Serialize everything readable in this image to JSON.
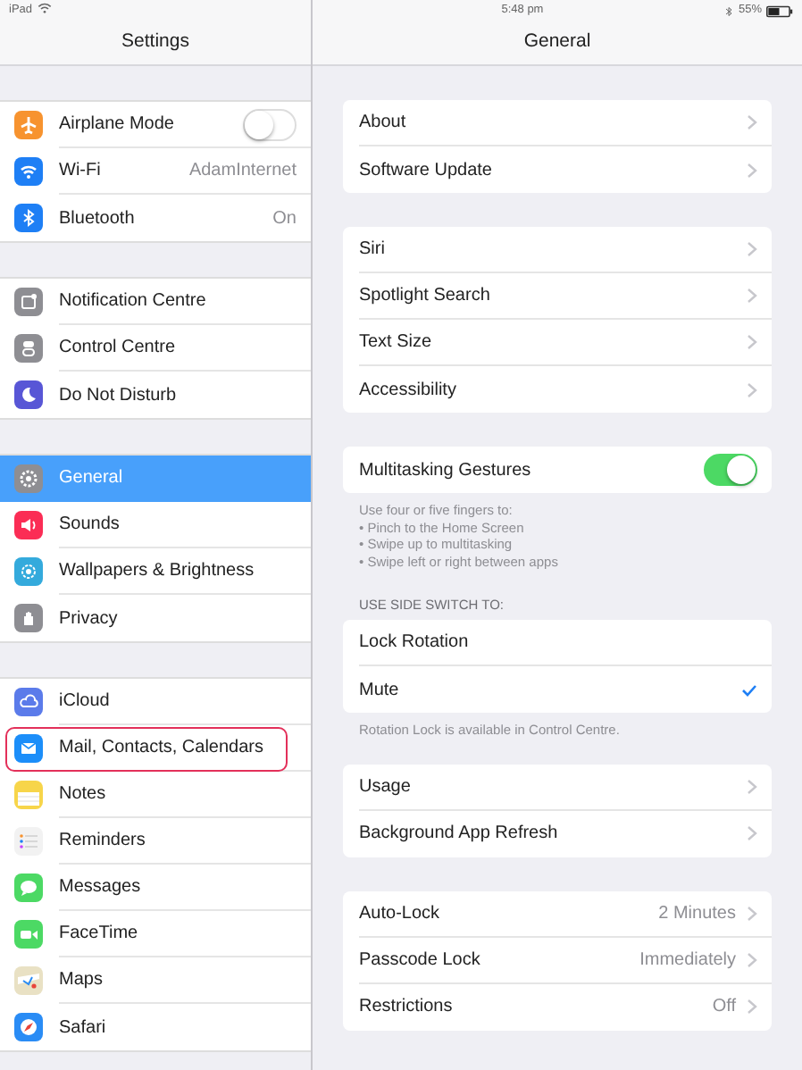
{
  "status_bar": {
    "device": "iPad",
    "time": "5:48 pm",
    "battery": "55%"
  },
  "sidebar": {
    "title": "Settings",
    "groups": [
      [
        {
          "label": "Airplane Mode",
          "color": "#f7932f",
          "kind": "toggle",
          "on": false,
          "selected": false,
          "outlined": false
        },
        {
          "label": "Wi-Fi",
          "color": "#1e7ff5",
          "kind": "value",
          "value": "AdamInternet",
          "selected": false,
          "outlined": false
        },
        {
          "label": "Bluetooth",
          "color": "#1e7ff5",
          "kind": "value",
          "value": "On",
          "selected": false,
          "outlined": false
        }
      ],
      [
        {
          "label": "Notification Centre",
          "color": "#8e8e93",
          "kind": "plain",
          "selected": false,
          "outlined": false
        },
        {
          "label": "Control Centre",
          "color": "#8e8e93",
          "kind": "plain",
          "selected": false,
          "outlined": false
        },
        {
          "label": "Do Not Disturb",
          "color": "#5856d6",
          "kind": "plain",
          "selected": false,
          "outlined": false
        }
      ],
      [
        {
          "label": "General",
          "color": "#8e8e93",
          "kind": "plain",
          "selected": true,
          "outlined": false
        },
        {
          "label": "Sounds",
          "color": "#fb2d55",
          "kind": "plain",
          "selected": false,
          "outlined": false
        },
        {
          "label": "Wallpapers & Brightness",
          "color": "#34aadc",
          "kind": "plain",
          "selected": false,
          "outlined": false
        },
        {
          "label": "Privacy",
          "color": "#8e8e93",
          "kind": "plain",
          "selected": false,
          "outlined": false
        }
      ],
      [
        {
          "label": "iCloud",
          "color": "#5b7bea",
          "kind": "plain",
          "selected": false,
          "outlined": false
        },
        {
          "label": "Mail, Contacts, Calendars",
          "color": "#1c8ef9",
          "kind": "plain",
          "selected": false,
          "outlined": true
        },
        {
          "label": "Notes",
          "color": "#f7d54a",
          "kind": "plain",
          "selected": false,
          "outlined": false
        },
        {
          "label": "Reminders",
          "color": "#f2f2f2",
          "kind": "plain",
          "selected": false,
          "outlined": false
        },
        {
          "label": "Messages",
          "color": "#4cd964",
          "kind": "plain",
          "selected": false,
          "outlined": false
        },
        {
          "label": "FaceTime",
          "color": "#4cd964",
          "kind": "plain",
          "selected": false,
          "outlined": false
        },
        {
          "label": "Maps",
          "color": "#e9e1c4",
          "kind": "plain",
          "selected": false,
          "outlined": false
        },
        {
          "label": "Safari",
          "color": "#2a8cf5",
          "kind": "plain",
          "selected": false,
          "outlined": false
        }
      ]
    ]
  },
  "detail": {
    "title": "General",
    "sections": [
      {
        "rows": [
          {
            "kind": "link",
            "label": "About"
          },
          {
            "kind": "link",
            "label": "Software Update"
          }
        ]
      },
      {
        "rows": [
          {
            "kind": "link",
            "label": "Siri"
          },
          {
            "kind": "link",
            "label": "Spotlight Search"
          },
          {
            "kind": "link",
            "label": "Text Size"
          },
          {
            "kind": "link",
            "label": "Accessibility"
          }
        ]
      },
      {
        "rows": [
          {
            "kind": "toggle",
            "label": "Multitasking Gestures",
            "on": true
          }
        ],
        "footer": [
          "Use four or five fingers to:",
          "• Pinch to the Home Screen",
          "• Swipe up to multitasking",
          "• Swipe left or right between apps"
        ]
      },
      {
        "header": "USE SIDE SWITCH TO:",
        "rows": [
          {
            "kind": "check",
            "label": "Lock Rotation",
            "checked": false
          },
          {
            "kind": "check",
            "label": "Mute",
            "checked": true
          }
        ],
        "footer": [
          "Rotation Lock is available in Control Centre."
        ]
      },
      {
        "rows": [
          {
            "kind": "link",
            "label": "Usage"
          },
          {
            "kind": "link",
            "label": "Background App Refresh"
          }
        ]
      },
      {
        "rows": [
          {
            "kind": "link",
            "label": "Auto-Lock",
            "value": "2 Minutes"
          },
          {
            "kind": "link",
            "label": "Passcode Lock",
            "value": "Immediately"
          },
          {
            "kind": "link",
            "label": "Restrictions",
            "value": "Off"
          }
        ]
      }
    ]
  }
}
